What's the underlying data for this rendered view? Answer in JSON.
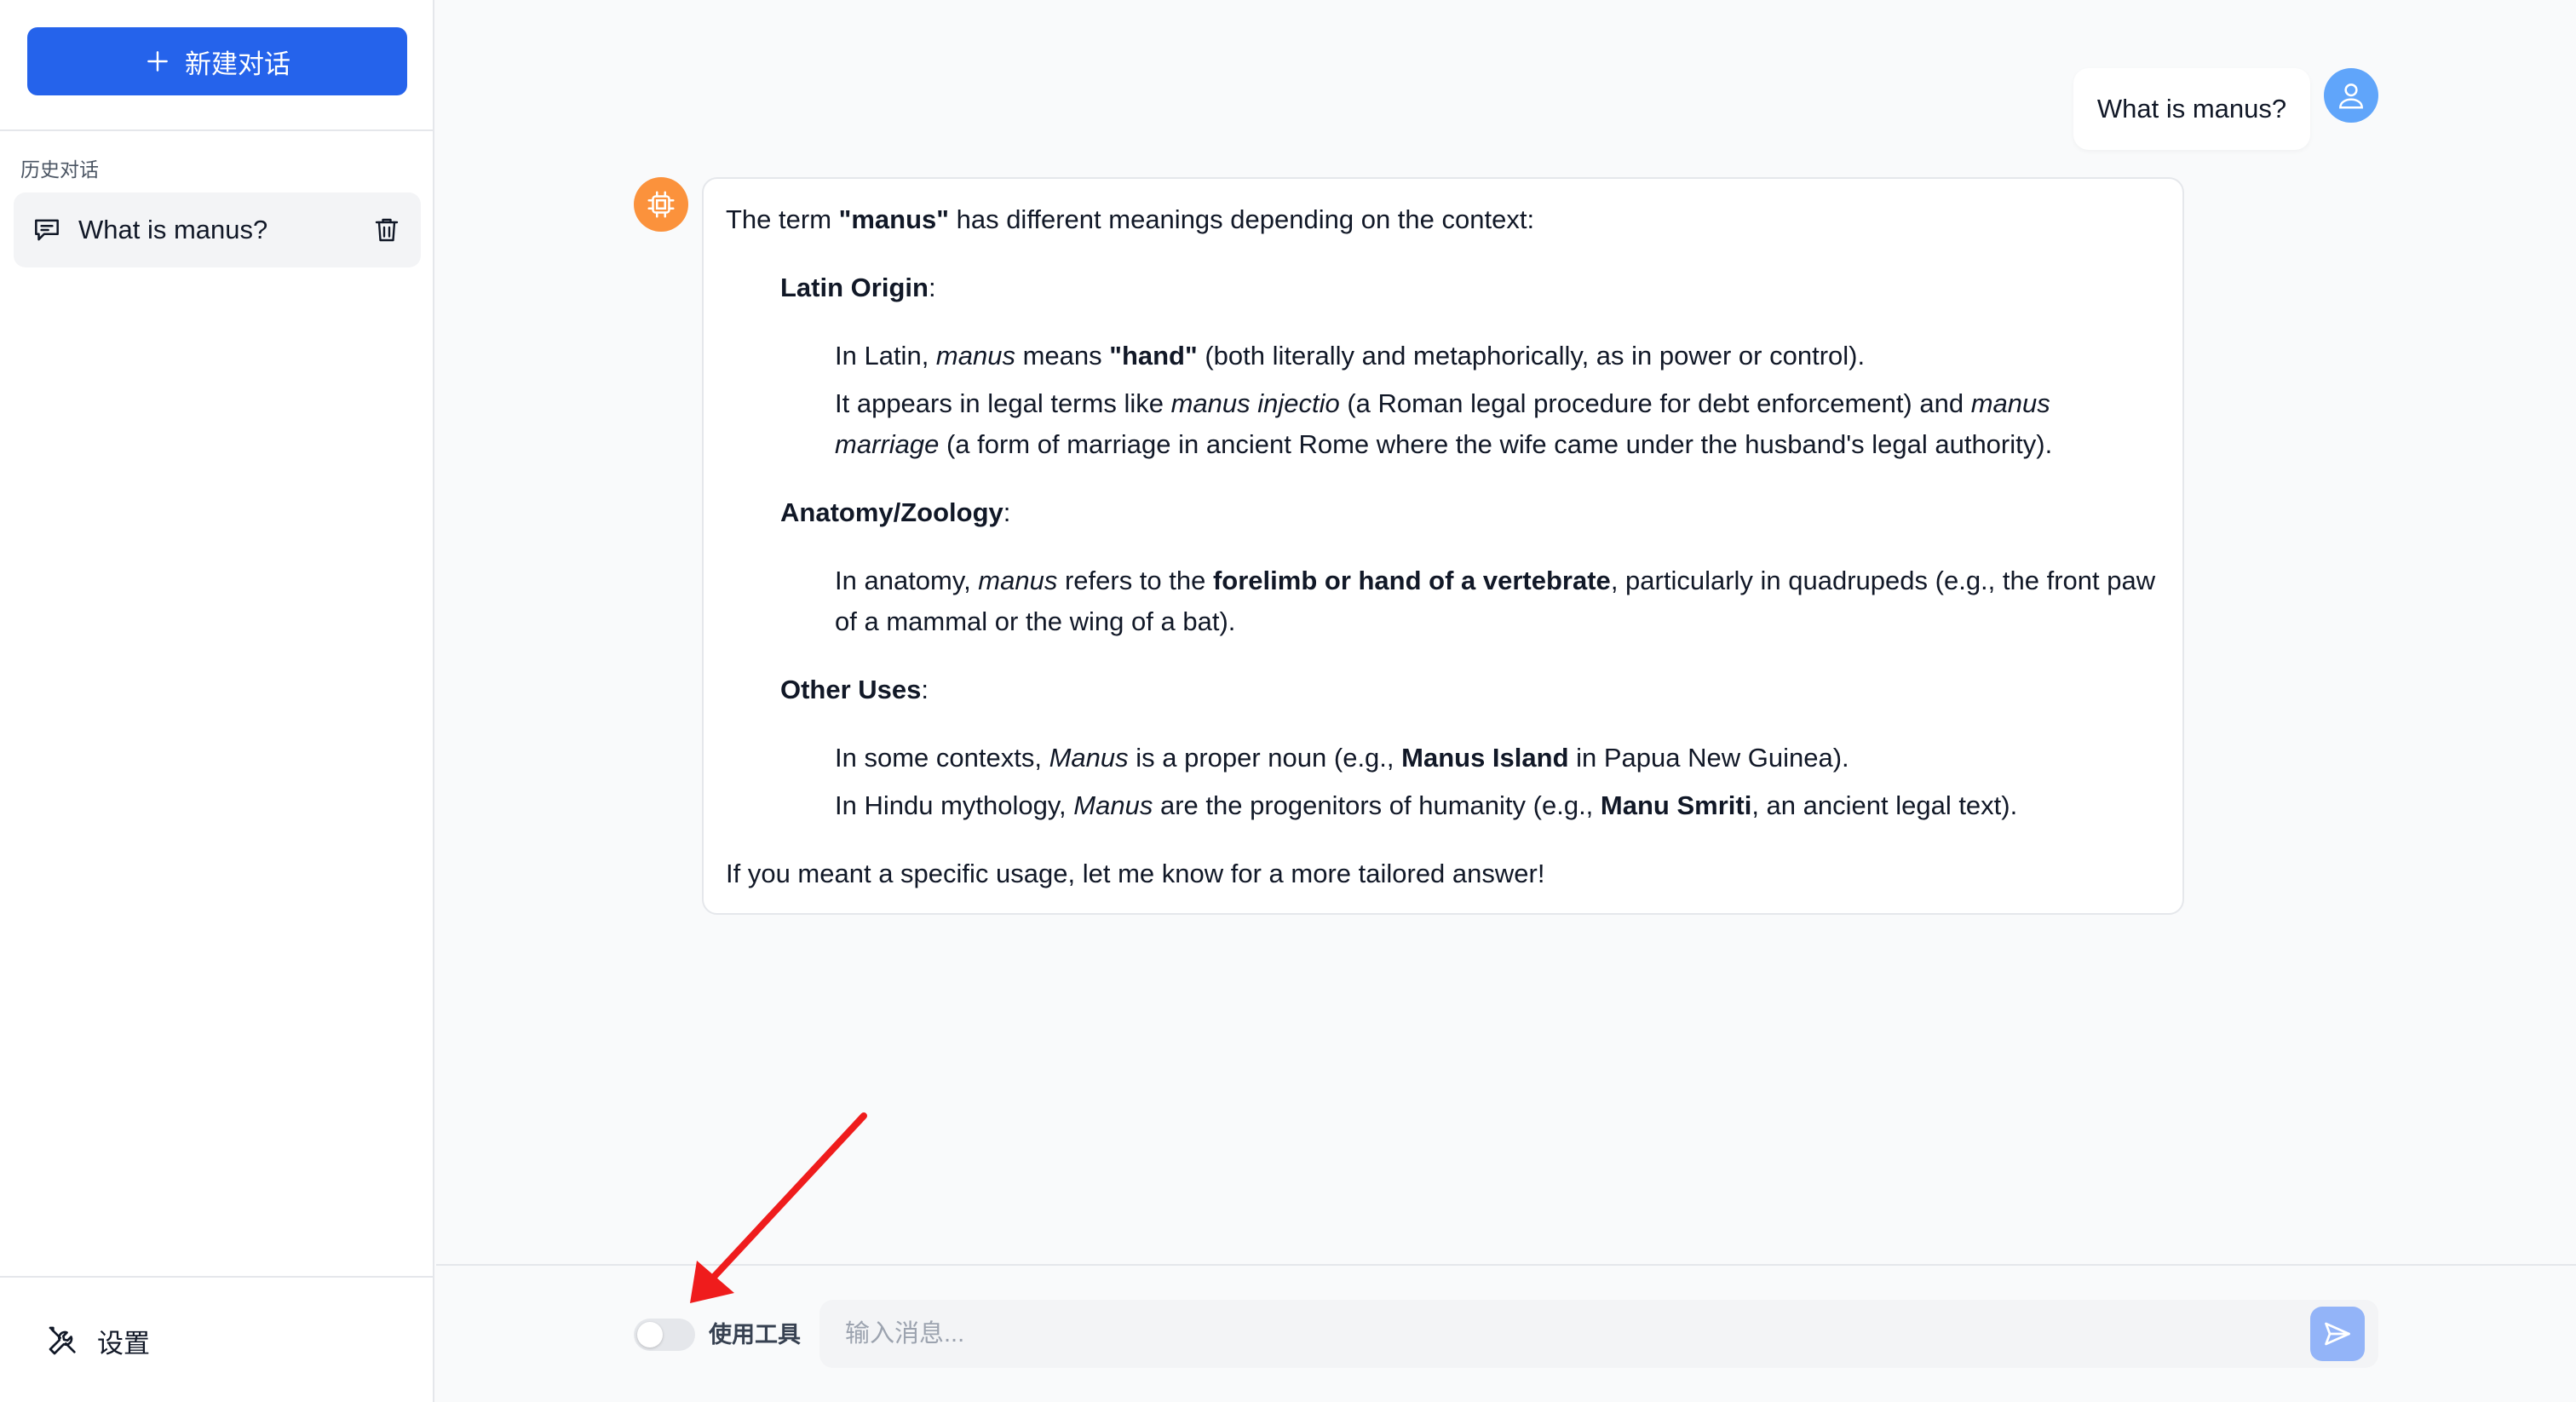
{
  "sidebar": {
    "new_chat_label": "新建对话",
    "history_heading": "历史对话",
    "history_items": [
      {
        "title": "What is manus?"
      }
    ],
    "settings_label": "设置"
  },
  "chat": {
    "user_message": "What is manus?",
    "bot_message": {
      "intro_before": "The term ",
      "intro_bold": "\"manus\"",
      "intro_after": " has different meanings depending on the context:",
      "sections": [
        {
          "heading": "Latin Origin",
          "items": [
            [
              {
                "t": "In Latin, "
              },
              {
                "t": "manus",
                "s": "i"
              },
              {
                "t": " means "
              },
              {
                "t": "\"hand\"",
                "s": "b"
              },
              {
                "t": " (both literally and metaphorically, as in power or control)."
              }
            ],
            [
              {
                "t": "It appears in legal terms like "
              },
              {
                "t": "manus injectio",
                "s": "i"
              },
              {
                "t": " (a Roman legal procedure for debt enforcement) and "
              },
              {
                "t": "manus marriage",
                "s": "i"
              },
              {
                "t": " (a form of marriage in ancient Rome where the wife came under the husband's legal authority)."
              }
            ]
          ]
        },
        {
          "heading": "Anatomy/Zoology",
          "items": [
            [
              {
                "t": "In anatomy, "
              },
              {
                "t": "manus",
                "s": "i"
              },
              {
                "t": " refers to the "
              },
              {
                "t": "forelimb or hand of a vertebrate",
                "s": "b"
              },
              {
                "t": ", particularly in quadrupeds (e.g., the front paw of a mammal or the wing of a bat)."
              }
            ]
          ]
        },
        {
          "heading": "Other Uses",
          "items": [
            [
              {
                "t": "In some contexts, "
              },
              {
                "t": "Manus",
                "s": "i"
              },
              {
                "t": " is a proper noun (e.g., "
              },
              {
                "t": "Manus Island",
                "s": "b"
              },
              {
                "t": " in Papua New Guinea)."
              }
            ],
            [
              {
                "t": "In Hindu mythology, "
              },
              {
                "t": "Manus",
                "s": "i"
              },
              {
                "t": " are the progenitors of humanity (e.g., "
              },
              {
                "t": "Manu Smriti",
                "s": "b"
              },
              {
                "t": ", an ancient legal text)."
              }
            ]
          ]
        }
      ],
      "closing": "If you meant a specific usage, let me know for a more tailored answer!"
    }
  },
  "input": {
    "tool_toggle_label": "使用工具",
    "tool_toggle_on": false,
    "placeholder": "输入消息...",
    "value": ""
  },
  "colors": {
    "primary": "#2563eb",
    "user_avatar": "#60a5fa",
    "bot_avatar": "#fb923c",
    "annotation_arrow": "#ef1c1c",
    "send_button": "#93b4f8"
  },
  "icons": {
    "new_chat": "plus-icon",
    "history_item": "chat-bubble-icon",
    "delete": "trash-icon",
    "settings": "tools-icon",
    "user_avatar": "user-icon",
    "bot_avatar": "cpu-icon",
    "send": "send-icon"
  }
}
